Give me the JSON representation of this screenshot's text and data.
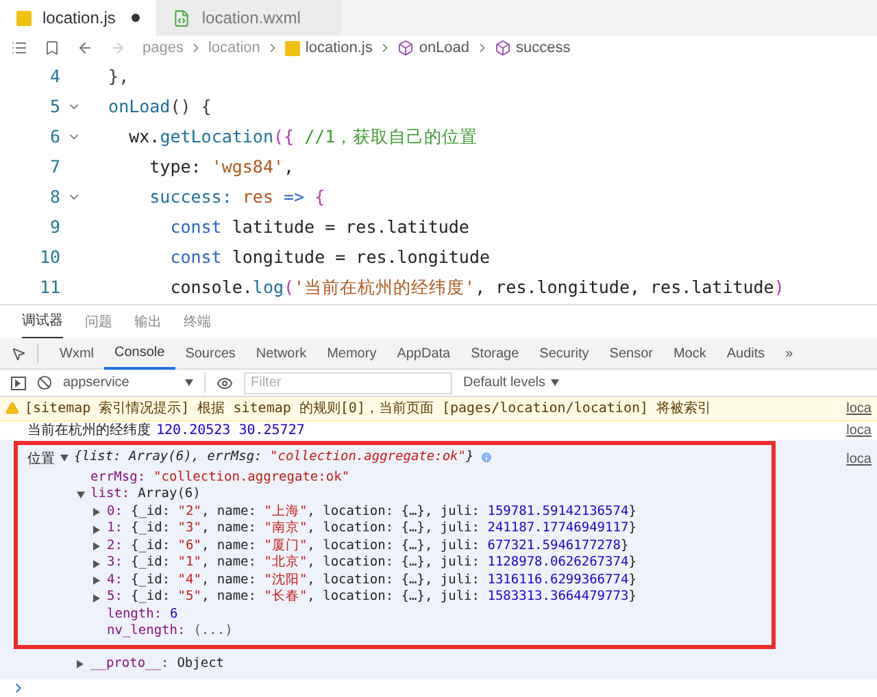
{
  "editor_tabs": [
    {
      "label": "location.js",
      "kind": "js",
      "selected": true,
      "modified": true
    },
    {
      "label": "location.wxml",
      "kind": "wxml",
      "selected": false,
      "modified": false
    }
  ],
  "breadcrumb": [
    {
      "label": "pages",
      "kind": "folder"
    },
    {
      "label": "location",
      "kind": "folder"
    },
    {
      "label": "location.js",
      "kind": "js"
    },
    {
      "label": "onLoad",
      "kind": "method"
    },
    {
      "label": "success",
      "kind": "method"
    }
  ],
  "code_lines": [
    {
      "number": "4",
      "foldable": false,
      "tokens": [
        {
          "text": "  },",
          "kind": "punct"
        }
      ]
    },
    {
      "number": "5",
      "foldable": true,
      "tokens": [
        {
          "text": "  onLoad",
          "kind": "func"
        },
        {
          "text": "() {",
          "kind": "punct"
        }
      ]
    },
    {
      "number": "6",
      "foldable": true,
      "tokens": [
        {
          "text": "    wx.",
          "kind": "plain"
        },
        {
          "text": "getLocation",
          "kind": "func"
        },
        {
          "text": "({ ",
          "kind": "bracket"
        },
        {
          "text": "//1，获取自己的位置",
          "kind": "comment"
        }
      ]
    },
    {
      "number": "7",
      "foldable": false,
      "tokens": [
        {
          "text": "      type: ",
          "kind": "plain"
        },
        {
          "text": "'wgs84'",
          "kind": "string"
        },
        {
          "text": ",",
          "kind": "plain"
        }
      ]
    },
    {
      "number": "8",
      "foldable": true,
      "tokens": [
        {
          "text": "      success: ",
          "kind": "func"
        },
        {
          "text": "res",
          "kind": "param"
        },
        {
          "text": " => ",
          "kind": "keyword"
        },
        {
          "text": "{",
          "kind": "bracket"
        }
      ]
    },
    {
      "number": "9",
      "foldable": false,
      "tokens": [
        {
          "text": "        const ",
          "kind": "keyword"
        },
        {
          "text": "latitude = res.latitude",
          "kind": "plain"
        }
      ]
    },
    {
      "number": "10",
      "foldable": false,
      "tokens": [
        {
          "text": "        const ",
          "kind": "keyword"
        },
        {
          "text": "longitude = res.longitude",
          "kind": "plain"
        }
      ]
    },
    {
      "number": "11",
      "foldable": false,
      "tokens": [
        {
          "text": "        console.",
          "kind": "plain"
        },
        {
          "text": "log",
          "kind": "func"
        },
        {
          "text": "(",
          "kind": "bracket"
        },
        {
          "text": "'当前在杭州的经纬度'",
          "kind": "string"
        },
        {
          "text": ", res.longitude, res.latitude",
          "kind": "plain"
        },
        {
          "text": ")",
          "kind": "bracket"
        }
      ]
    }
  ],
  "panel_tabs": [
    {
      "label": "调试器",
      "selected": true
    },
    {
      "label": "问题",
      "selected": false
    },
    {
      "label": "输出",
      "selected": false
    },
    {
      "label": "终端",
      "selected": false
    }
  ],
  "devtools_tabs": [
    {
      "label": "Wxml",
      "selected": false
    },
    {
      "label": "Console",
      "selected": true
    },
    {
      "label": "Sources",
      "selected": false
    },
    {
      "label": "Network",
      "selected": false
    },
    {
      "label": "Memory",
      "selected": false
    },
    {
      "label": "AppData",
      "selected": false
    },
    {
      "label": "Storage",
      "selected": false
    },
    {
      "label": "Security",
      "selected": false
    },
    {
      "label": "Sensor",
      "selected": false
    },
    {
      "label": "Mock",
      "selected": false
    },
    {
      "label": "Audits",
      "selected": false
    },
    {
      "label": "»",
      "selected": false
    }
  ],
  "console_toolbar": {
    "context": "appservice",
    "filter_placeholder": "Filter",
    "levels": "Default levels"
  },
  "messages": [
    {
      "kind": "warning",
      "text": "[sitemap 索引情况提示] 根据 sitemap 的规则[0]，当前页面 [pages/location/location] 将被索引",
      "source": "loca"
    },
    {
      "kind": "log",
      "label": "当前在杭州的经纬度",
      "values": "120.20523 30.25727",
      "source": "loca"
    },
    {
      "kind": "object",
      "label": "位置",
      "summary": "{list: Array(6), errMsg: \"collection.aggregate:ok\"}",
      "expanded": true,
      "source": "loca",
      "highlighted": true,
      "children": [
        {
          "key": "errMsg:",
          "value": "\"collection.aggregate:ok\"",
          "expandable": false
        },
        {
          "key": "list:",
          "value": "Array(6)",
          "expandable": true,
          "expanded": true,
          "children": [
            {
              "key": "0:",
              "value": "{_id: \"2\", name: \"上海\", location: {…}, juli: 159781.59142136574}",
              "expandable": true,
              "expanded": false
            },
            {
              "key": "1:",
              "value": "{_id: \"3\", name: \"南京\", location: {…}, juli: 241187.17746949117}",
              "expandable": true,
              "expanded": false
            },
            {
              "key": "2:",
              "value": "{_id: \"6\", name: \"厦门\", location: {…}, juli: 677321.5946177278}",
              "expandable": true,
              "expanded": false
            },
            {
              "key": "3:",
              "value": "{_id: \"1\", name: \"北京\", location: {…}, juli: 1128978.0626267374}",
              "expandable": true,
              "expanded": false
            },
            {
              "key": "4:",
              "value": "{_id: \"4\", name: \"沈阳\", location: {…}, juli: 1316116.6299366774}",
              "expandable": true,
              "expanded": false
            },
            {
              "key": "5:",
              "value": "{_id: \"5\", name: \"长春\", location: {…}, juli: 1583313.3664479773}",
              "expandable": true,
              "expanded": false
            },
            {
              "key": "length:",
              "value": "6",
              "expandable": false
            },
            {
              "key": "nv_length:",
              "value": "(...)",
              "expandable": false
            }
          ]
        },
        {
          "key": "__proto__:",
          "value": "Object",
          "expandable": true,
          "expanded": false
        }
      ]
    }
  ]
}
